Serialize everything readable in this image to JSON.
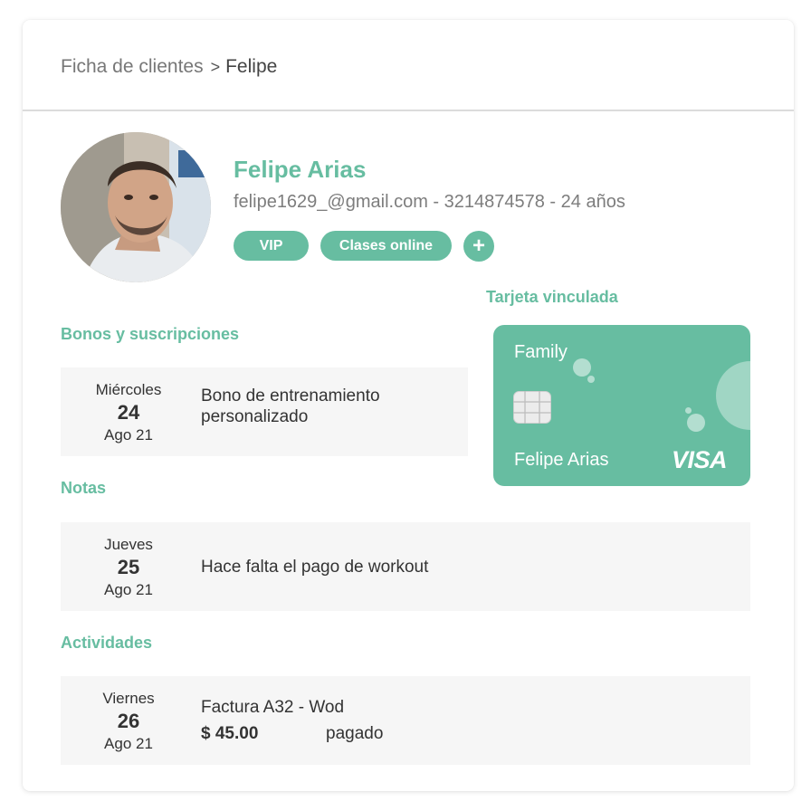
{
  "breadcrumb": {
    "parent": "Ficha de clientes",
    "separator": ">",
    "current": "Felipe"
  },
  "client": {
    "name": "Felipe Arias",
    "meta": "felipe1629_@gmail.com - 3214874578 - 24 años",
    "tags": [
      "VIP",
      "Clases online"
    ],
    "add_tag": "+"
  },
  "linked_card": {
    "title": "Tarjeta vinculada",
    "brand_name": "Family",
    "holder": "Felipe Arias",
    "network": "VISA"
  },
  "sections": {
    "bonos": {
      "title": "Bonos y suscripciones",
      "entries": [
        {
          "day": "Miércoles",
          "num": "24",
          "month": "Ago 21",
          "text": "Bono de entrenamiento personalizado"
        }
      ]
    },
    "notas": {
      "title": "Notas",
      "entries": [
        {
          "day": "Jueves",
          "num": "25",
          "month": "Ago 21",
          "text": "Hace falta el pago de workout"
        }
      ]
    },
    "actividades": {
      "title": "Actividades",
      "entries": [
        {
          "day": "Viernes",
          "num": "26",
          "month": "Ago 21",
          "text": "Factura A32 - Wod",
          "amount": "$ 45.00",
          "status": "pagado"
        }
      ]
    }
  },
  "colors": {
    "accent": "#67bda1",
    "entry_bg": "#f6f6f6",
    "text_muted": "#7d7d7d"
  },
  "icons": [
    "chevron-right-icon",
    "plus-icon",
    "card-chip-icon",
    "visa-logo"
  ]
}
